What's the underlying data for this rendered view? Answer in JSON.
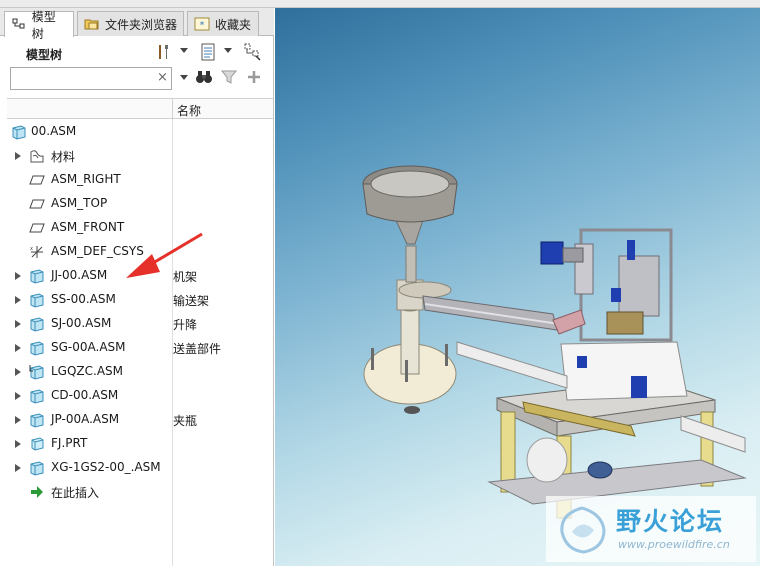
{
  "tabs": [
    {
      "label": "模型树",
      "active": true,
      "icon": "model-tree-icon"
    },
    {
      "label": "文件夹浏览器",
      "active": false,
      "icon": "folder-browser-icon"
    },
    {
      "label": "收藏夹",
      "active": false,
      "icon": "favorites-icon"
    }
  ],
  "tree_toolbar": {
    "title": "模型树",
    "tools": [
      "settings-tools-icon",
      "show-options-icon",
      "tree-filter-icon"
    ]
  },
  "search": {
    "value": "",
    "placeholder": "",
    "clear_glyph": "×"
  },
  "columns": {
    "name_header": "名称"
  },
  "tree": {
    "items": [
      {
        "label": "00.ASM",
        "name": "",
        "icon": "assembly-icon",
        "expandable": false,
        "level": 0
      },
      {
        "label": "材料",
        "name": "",
        "icon": "material-icon",
        "expandable": true,
        "level": 1
      },
      {
        "label": "ASM_RIGHT",
        "name": "",
        "icon": "datum-plane-icon",
        "expandable": false,
        "level": 1
      },
      {
        "label": "ASM_TOP",
        "name": "",
        "icon": "datum-plane-icon",
        "expandable": false,
        "level": 1
      },
      {
        "label": "ASM_FRONT",
        "name": "",
        "icon": "datum-plane-icon",
        "expandable": false,
        "level": 1
      },
      {
        "label": "ASM_DEF_CSYS",
        "name": "",
        "icon": "coordinate-system-icon",
        "expandable": false,
        "level": 1
      },
      {
        "label": "JJ-00.ASM",
        "name": "机架",
        "icon": "assembly-icon",
        "expandable": true,
        "level": 1
      },
      {
        "label": "SS-00.ASM",
        "name": "输送架",
        "icon": "assembly-icon",
        "expandable": true,
        "level": 1
      },
      {
        "label": "SJ-00.ASM",
        "name": "升降",
        "icon": "assembly-icon",
        "expandable": true,
        "level": 1
      },
      {
        "label": "SG-00A.ASM",
        "name": "送盖部件",
        "icon": "assembly-icon",
        "expandable": true,
        "level": 1
      },
      {
        "label": "LGQZC.ASM",
        "name": "",
        "icon": "assembly-icon",
        "expandable": true,
        "level": 1
      },
      {
        "label": "CD-00.ASM",
        "name": "",
        "icon": "assembly-icon",
        "expandable": true,
        "level": 1
      },
      {
        "label": "JP-00A.ASM",
        "name": "夹瓶",
        "icon": "assembly-icon",
        "expandable": true,
        "level": 1
      },
      {
        "label": "FJ.PRT",
        "name": "",
        "icon": "part-icon",
        "expandable": true,
        "level": 1
      },
      {
        "label": "XG-1GS2-00_.ASM",
        "name": "",
        "icon": "assembly-icon",
        "expandable": true,
        "level": 1
      },
      {
        "label": "在此插入",
        "name": "",
        "icon": "insert-here-icon",
        "expandable": false,
        "level": 1
      }
    ]
  },
  "annotation": {
    "color": "#e5312a"
  },
  "viewport": {
    "model": "3d-assembly-model"
  },
  "watermark": {
    "title": "野火论坛",
    "url": "www.proewildfire.cn"
  },
  "colors": {
    "accent": "#3aa0d8",
    "arrow": "#e5312a",
    "viewport_top": "#2f6f9c",
    "viewport_bottom": "#e9f6f7"
  }
}
